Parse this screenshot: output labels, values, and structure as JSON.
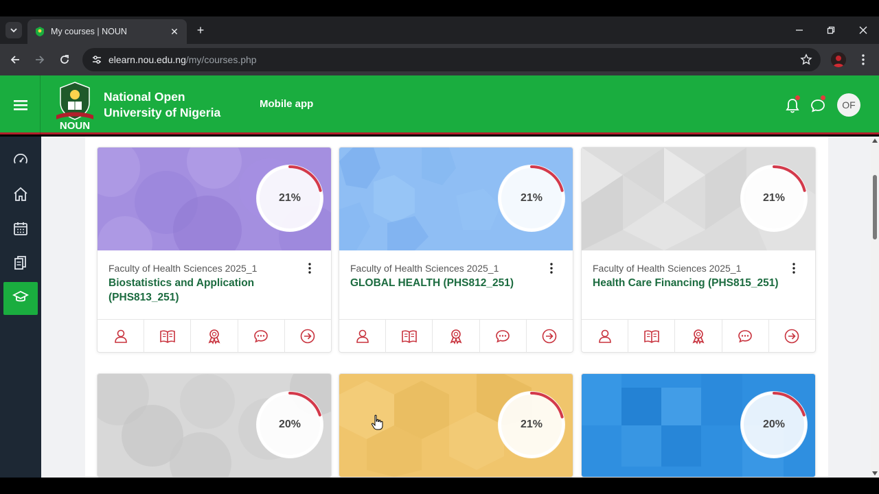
{
  "browser": {
    "tab_title": "My courses | NOUN",
    "url_host": "elearn.nou.edu.ng",
    "url_path": "/my/courses.php",
    "icons": [
      "tab-search-icon",
      "close-icon",
      "plus-icon",
      "minimize-icon",
      "restore-icon",
      "close-window-icon",
      "back-icon",
      "forward-icon",
      "reload-icon",
      "site-info-icon",
      "star-icon",
      "kebab-menu-icon"
    ]
  },
  "header": {
    "logo_text": "NOUN",
    "university_line1": "National Open",
    "university_line2": "University of Nigeria",
    "mobile_app": "Mobile app",
    "user_initials": "OF",
    "colors": {
      "brand_green": "#1aad3f",
      "accent_red": "#b11f2b",
      "title_green": "#1b6b3f",
      "ring_red": "#d33a4b"
    }
  },
  "rail": {
    "items": [
      {
        "icon": "dashboard-icon"
      },
      {
        "icon": "home-icon"
      },
      {
        "icon": "calendar-icon"
      },
      {
        "icon": "content-bank-icon"
      },
      {
        "icon": "my-courses-icon",
        "active": true
      }
    ]
  },
  "courses": [
    {
      "category": "Faculty of Health Sciences 2025_1",
      "title": "Biostatistics and Application (PHS813_251)",
      "progress": 21,
      "progress_label": "21%",
      "theme": "purple"
    },
    {
      "category": "Faculty of Health Sciences 2025_1",
      "title": "GLOBAL HEALTH (PHS812_251)",
      "progress": 21,
      "progress_label": "21%",
      "theme": "blue"
    },
    {
      "category": "Faculty of Health Sciences 2025_1",
      "title": "Health Care Financing (PHS815_251)",
      "progress": 21,
      "progress_label": "21%",
      "theme": "gray"
    },
    {
      "progress": 20,
      "progress_label": "20%",
      "theme": "gray-circles"
    },
    {
      "progress": 21,
      "progress_label": "21%",
      "theme": "gold"
    },
    {
      "progress": 20,
      "progress_label": "20%",
      "theme": "bright-blue"
    }
  ],
  "card_actions": [
    "participants-icon",
    "grades-book-icon",
    "badges-icon",
    "chat-icon",
    "go-to-course-icon"
  ]
}
